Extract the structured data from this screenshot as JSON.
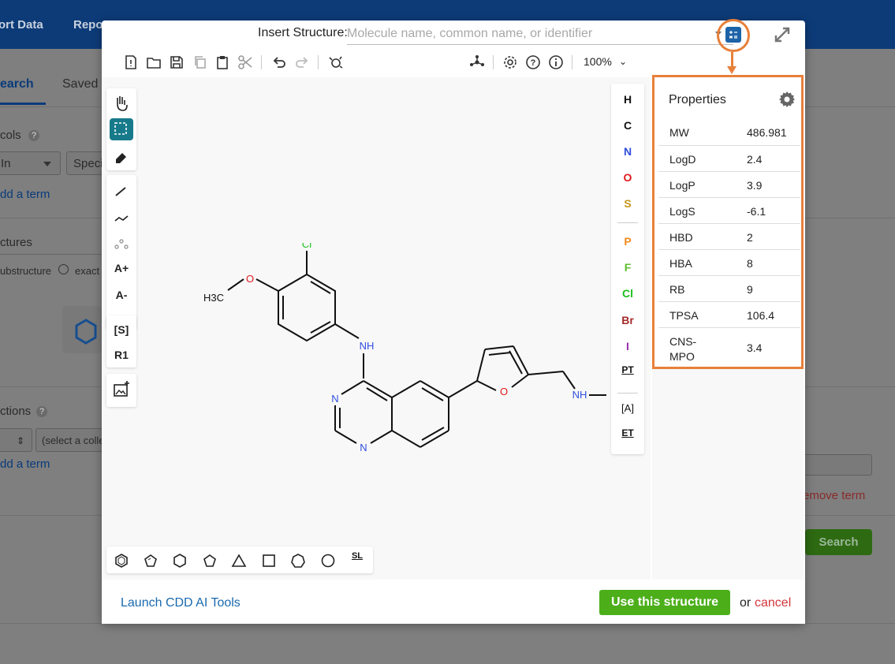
{
  "background": {
    "nav": [
      "ort Data",
      "Repo"
    ],
    "tabs": {
      "active": "earch",
      "other": "Saved"
    },
    "protocols_label": "cols",
    "protocols_help": "?",
    "select_in": "In",
    "select_spec": "Speci",
    "add_term_1": "dd a term",
    "structures_label": "ctures",
    "substructure_label": "ubstructure",
    "exact_label": "exact",
    "collections_label": "ctions",
    "collections_help": "?",
    "select_collection": "(select a colle",
    "add_term_2": "dd a term",
    "remove_term": "emove term",
    "search_button": "Search"
  },
  "modal": {
    "insert_label": "Insert Structure:",
    "insert_placeholder": "Molecule name, common name, or identifier",
    "zoom": "100%",
    "atoms": [
      "H",
      "C",
      "N",
      "O",
      "S",
      "P",
      "F",
      "Cl",
      "Br",
      "I",
      "PT"
    ],
    "atom_colors": {
      "H": "#111111",
      "C": "#111111",
      "N": "#2f4ee0",
      "O": "#e0191b",
      "S": "#c7961a",
      "P": "#f08a1d",
      "F": "#5cbf2a",
      "Cl": "#1cbf1c",
      "Br": "#a52a2a",
      "I": "#9b2fb0",
      "PT": "#111111"
    },
    "extra_tools": [
      "[A]",
      "ET"
    ],
    "left_tools": [
      "[S]",
      "R1",
      "A+",
      "A-"
    ],
    "shapes_label": "SL",
    "molecule": {
      "labels": {
        "cl": "Cl",
        "o_methoxy": "O",
        "h3c": "H3C",
        "nh1": "NH",
        "n1": "N",
        "n2": "N",
        "o_furan": "O",
        "nh2": "NH"
      }
    },
    "properties": {
      "title": "Properties",
      "rows": [
        {
          "key": "MW",
          "value": "486.981"
        },
        {
          "key": "LogD",
          "value": "2.4"
        },
        {
          "key": "LogP",
          "value": "3.9"
        },
        {
          "key": "LogS",
          "value": "-6.1"
        },
        {
          "key": "HBD",
          "value": "2"
        },
        {
          "key": "HBA",
          "value": "8"
        },
        {
          "key": "RB",
          "value": "9"
        },
        {
          "key": "TPSA",
          "value": "106.4"
        },
        {
          "key": "CNS-\nMPO",
          "value": "3.4"
        }
      ]
    },
    "footer": {
      "ai_link": "Launch CDD AI Tools",
      "use_button": "Use this structure",
      "or_text": "or",
      "cancel": "cancel"
    }
  }
}
